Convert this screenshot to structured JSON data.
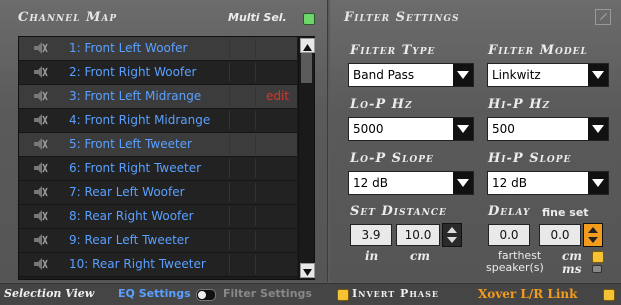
{
  "channel_map": {
    "title": "Channel Map",
    "multi_sel_label": "Multi Sel.",
    "edit_label": "edit",
    "channels": [
      {
        "label": "1: Front Left Woofer",
        "selected": true
      },
      {
        "label": "2: Front Right Woofer",
        "selected": false
      },
      {
        "label": "3: Front Left Midrange",
        "selected": true
      },
      {
        "label": "4: Front Right Midrange",
        "selected": false
      },
      {
        "label": "5: Front Left Tweeter",
        "selected": true
      },
      {
        "label": "6: Front Right Tweeter",
        "selected": false
      },
      {
        "label": "7: Rear Left Woofer",
        "selected": false
      },
      {
        "label": "8: Rear Right Woofer",
        "selected": false
      },
      {
        "label": "9: Rear Left Tweeter",
        "selected": false
      },
      {
        "label": "10: Rear Right Tweeter",
        "selected": false
      }
    ]
  },
  "filter_settings": {
    "title": "Filter Settings",
    "filter_type_label": "Filter Type",
    "filter_type_value": "Band Pass",
    "filter_model_label": "Filter Model",
    "filter_model_value": "Linkwitz",
    "lop_hz_label": "Lo-P Hz",
    "lop_hz_value": "5000",
    "hip_hz_label": "Hi-P Hz",
    "hip_hz_value": "500",
    "lop_slope_label": "Lo-P Slope",
    "lop_slope_value": "12 dB",
    "hip_slope_label": "Hi-P Slope",
    "hip_slope_value": "12 dB",
    "set_distance_label": "Set Distance",
    "distance_in": "3.9",
    "distance_cm": "10.0",
    "in_label": "in",
    "cm_label": "cm",
    "delay_label": "Delay",
    "fine_set_label": "fine set",
    "delay_value": "0.0",
    "delay_fine_value": "0.0",
    "farthest_label": "farthest",
    "speakers_label": "speaker(s)",
    "cm_unit_label": "cm",
    "ms_unit_label": "ms"
  },
  "bottom_bar": {
    "selection_view_label": "Selection View",
    "eq_settings_label": "EQ Settings",
    "filter_settings_label": "Filter Settings",
    "invert_phase_label": "Invert Phase",
    "xover_link_label": "Xover L/R Link"
  },
  "colors": {
    "accent_blue": "#5aa0ff",
    "edit_red": "#d03a2a",
    "xover_orange": "#f39b1d",
    "led_green": "#6cd86c",
    "led_yellow": "#f4c232"
  }
}
